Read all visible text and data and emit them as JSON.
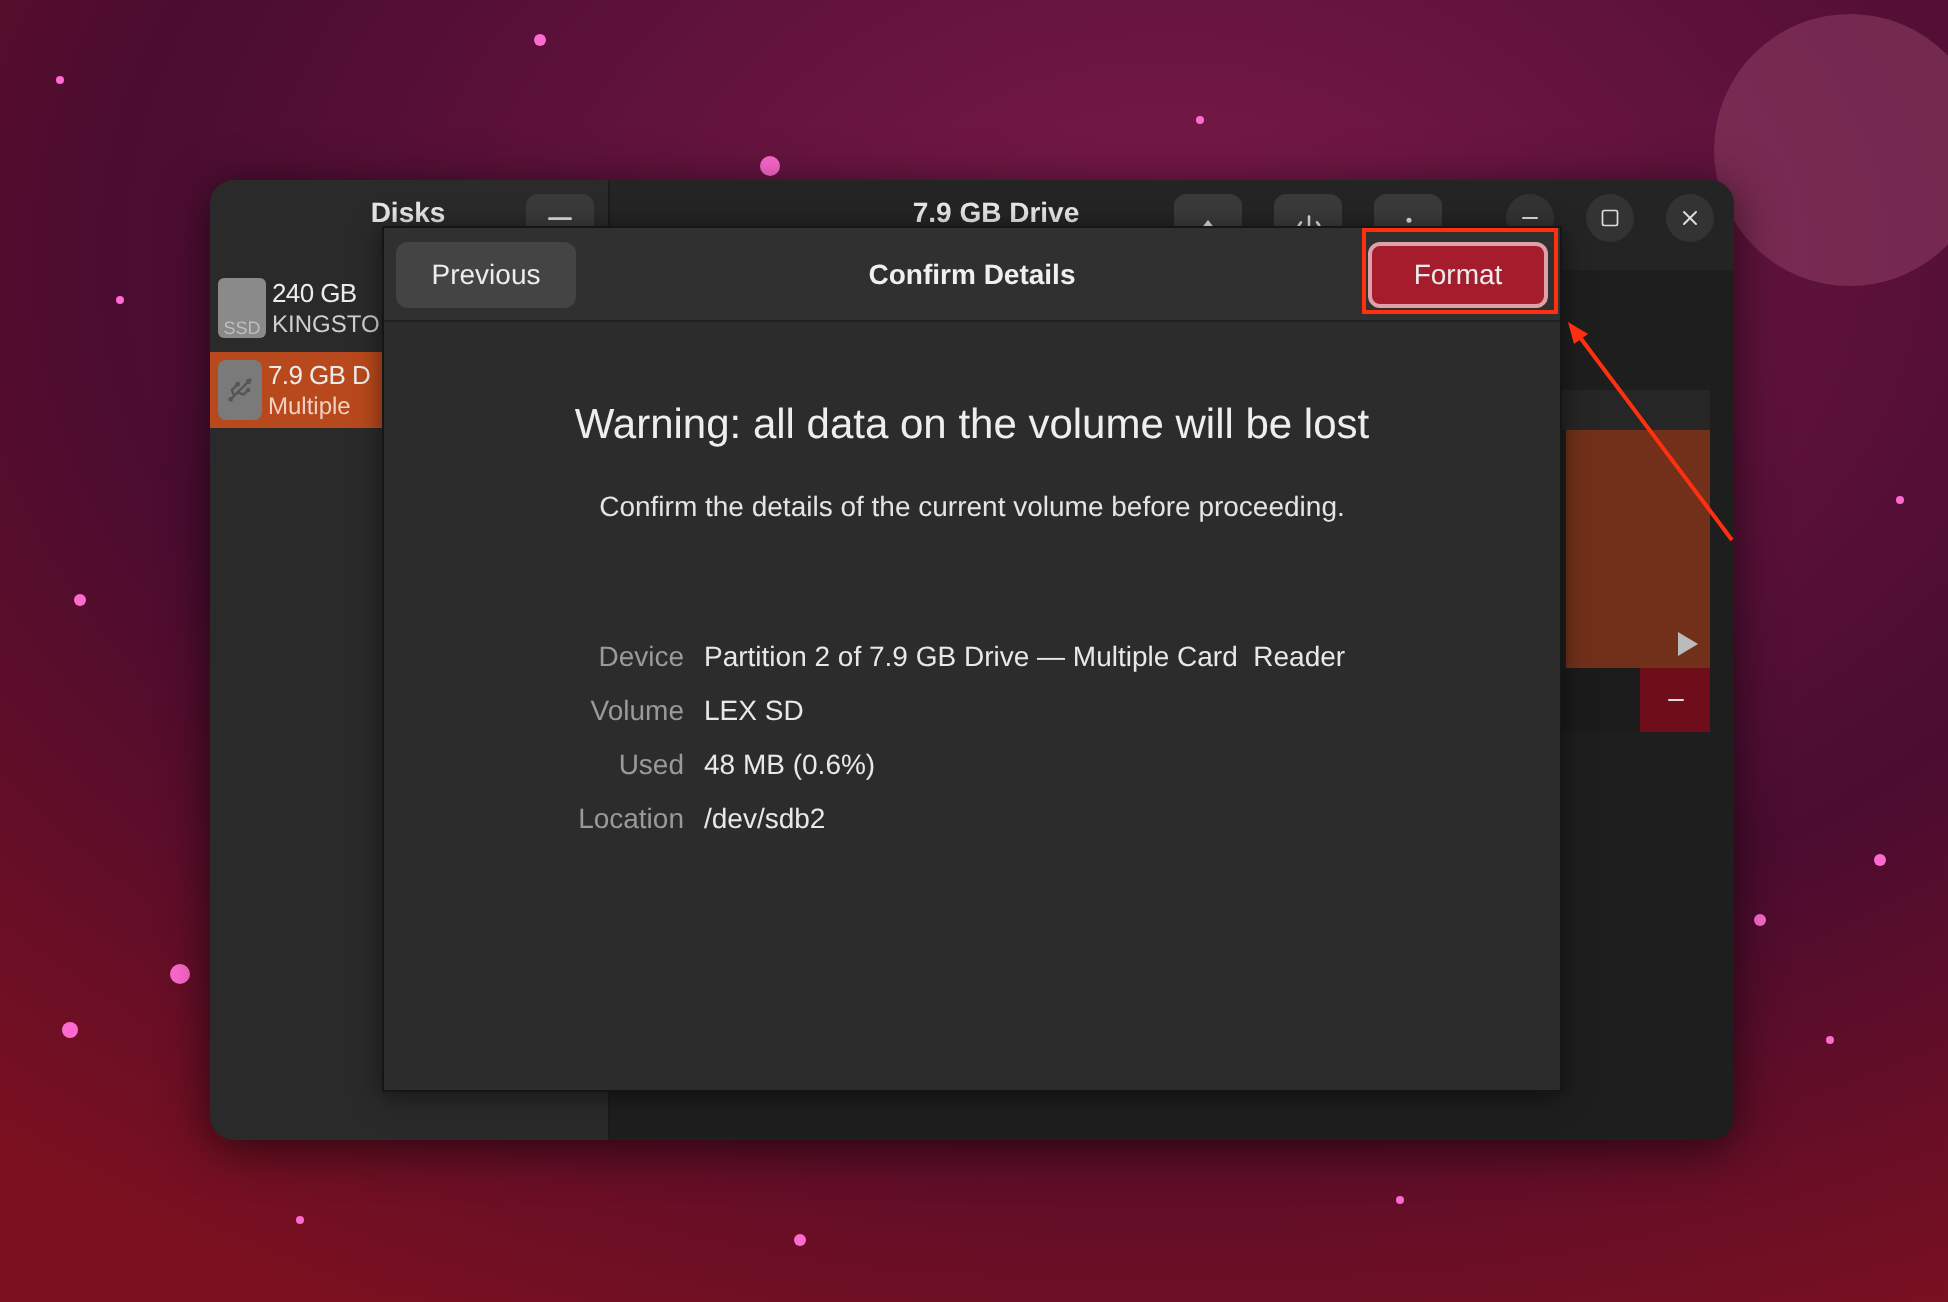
{
  "window": {
    "sidebar_title": "Disks",
    "title": "7.9 GB Drive"
  },
  "sidebar": {
    "items": [
      {
        "name": "240 GB",
        "model": "KINGSTO",
        "kind": "ssd",
        "icon_label": "SSD",
        "selected": false
      },
      {
        "name": "7.9 GB D",
        "model": "Multiple",
        "kind": "usb",
        "selected": true
      }
    ]
  },
  "dialog": {
    "title": "Confirm Details",
    "back_button": "Previous",
    "action_button": "Format",
    "heading": "Warning: all data on the volume will be lost",
    "message": "Confirm the details of the current volume before proceeding.",
    "details": [
      {
        "label": "Device",
        "value": "Partition 2 of 7.9 GB Drive — Multiple Card  Reader"
      },
      {
        "label": "Volume",
        "value": "LEX SD"
      },
      {
        "label": "Used",
        "value": "48 MB (0.6%)"
      },
      {
        "label": "Location",
        "value": "/dev/sdb2"
      }
    ]
  }
}
